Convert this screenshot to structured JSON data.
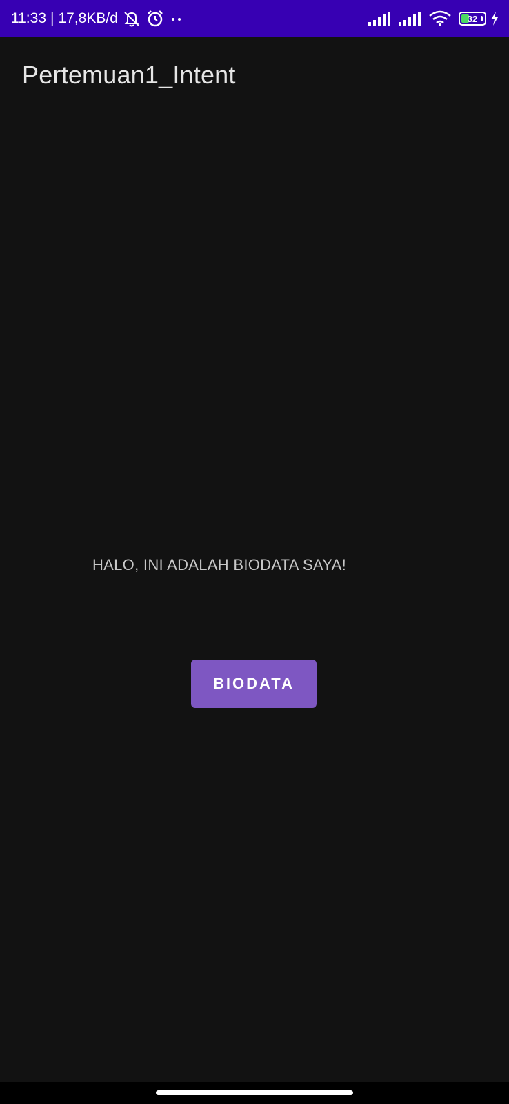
{
  "status_bar": {
    "time": "11:33",
    "separator": "|",
    "network_speed": "17,8KB/d",
    "battery_level": "32",
    "icons": [
      "notifications-off-icon",
      "alarm-icon",
      "more-dots-icon",
      "signal-icon",
      "signal-icon",
      "wifi-icon",
      "battery-icon",
      "charging-icon"
    ],
    "background_color": "#3700b3"
  },
  "app_bar": {
    "title": "Pertemuan1_Intent"
  },
  "main": {
    "message": "HALO, INI ADALAH BIODATA SAYA!",
    "button_label": "BIODATA",
    "button_color": "#7e57c2"
  }
}
